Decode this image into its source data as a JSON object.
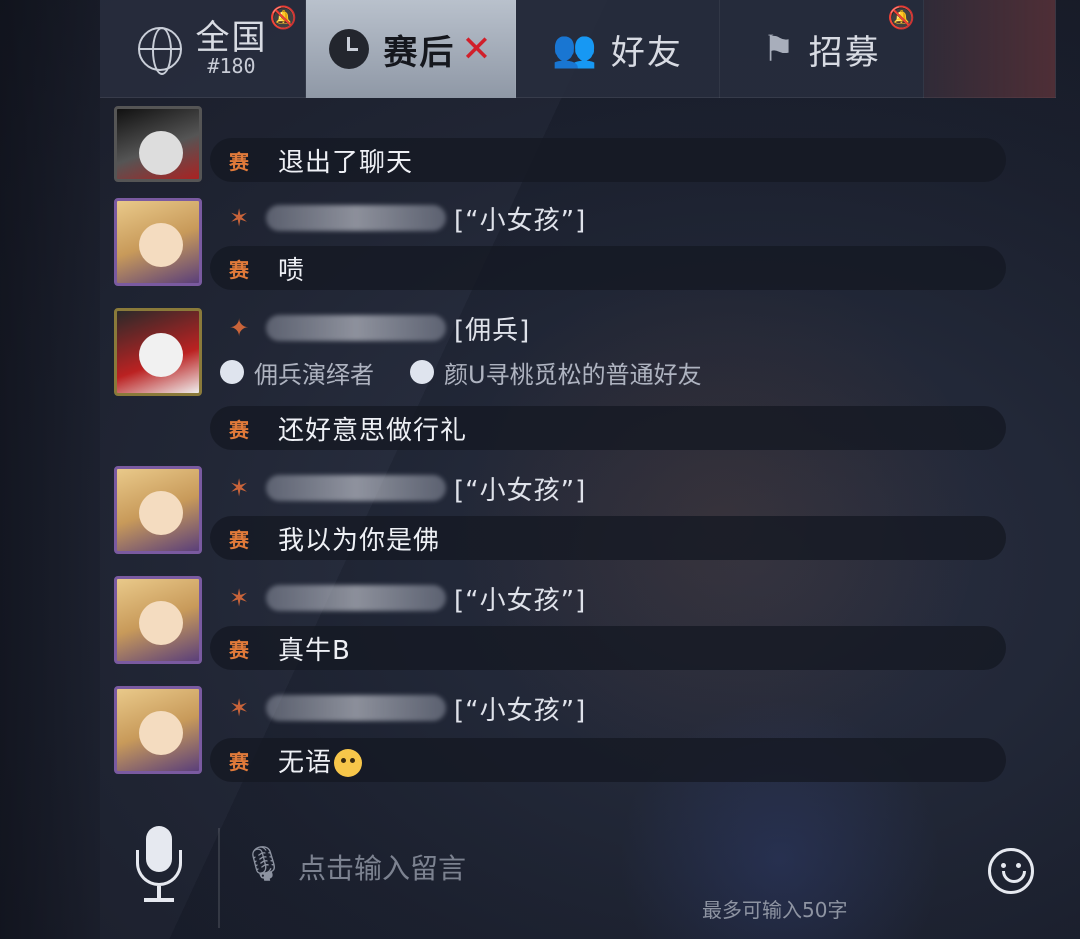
{
  "tabs": {
    "national": {
      "label": "全国",
      "count": "#180"
    },
    "postgame": {
      "label": "赛后"
    },
    "friends": {
      "label": "好友"
    },
    "recruit": {
      "label": "招募"
    }
  },
  "messages": [
    {
      "badge": "赛",
      "text": "退出了聊天"
    },
    {
      "title": "[“小女孩”]",
      "badge": "赛",
      "text": "啧"
    },
    {
      "title": "[佣兵]",
      "tags": [
        "佣兵演绎者",
        "颜U寻桃觅松的普通好友"
      ],
      "badge": "赛",
      "text": "还好意思做行礼"
    },
    {
      "title": "[“小女孩”]",
      "badge": "赛",
      "text": "我以为你是佛"
    },
    {
      "title": "[“小女孩”]",
      "badge": "赛",
      "text": "真牛B"
    },
    {
      "title": "[“小女孩”]",
      "badge": "赛",
      "text": "无语"
    }
  ],
  "input": {
    "placeholder": "点击输入留言",
    "limit": "最多可输入50字"
  },
  "colors": {
    "accent_red": "#d11f2a",
    "badge_orange": "#e07a3a",
    "tab_active": "#b9c1cc"
  }
}
